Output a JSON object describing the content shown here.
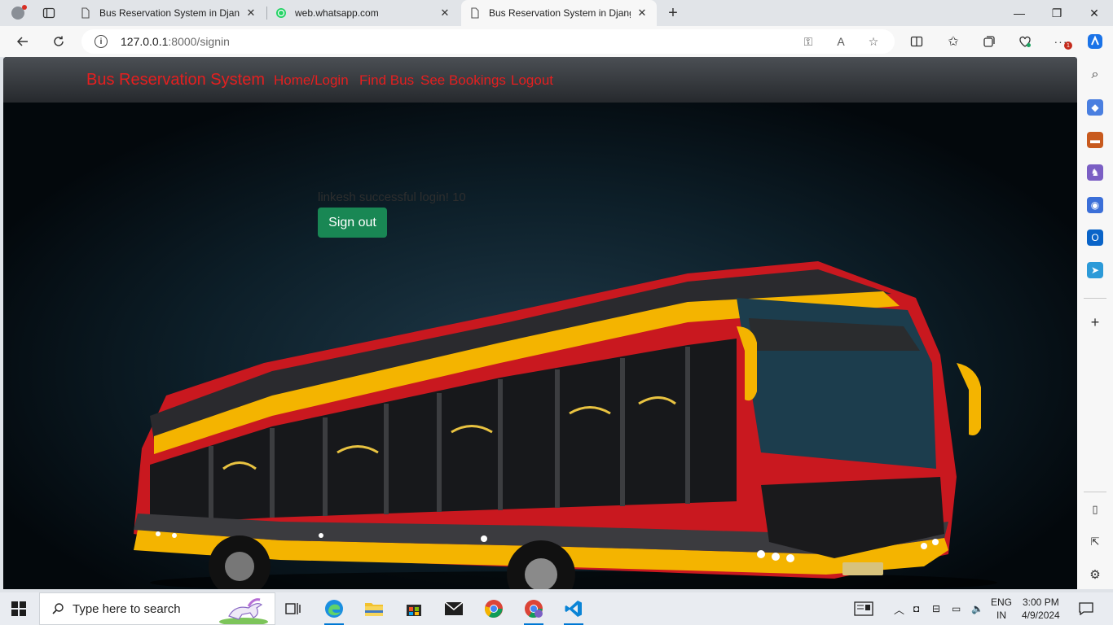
{
  "browser": {
    "tabs": [
      {
        "title": "Bus Reservation System in Djang",
        "active": false
      },
      {
        "title": "web.whatsapp.com",
        "active": false
      },
      {
        "title": "Bus Reservation System in Djang",
        "active": true
      }
    ],
    "url_host": "127.0.0.1",
    "url_rest": ":8000/signin"
  },
  "site": {
    "brand": "Bus Reservation System",
    "nav": {
      "home": "Home/Login",
      "find_bus": "Find Bus",
      "bookings": "See Bookings",
      "logout": "Logout"
    },
    "message": "linkesh successful login! 10",
    "signout_label": "Sign out",
    "accent_color": "#e41f1f",
    "button_color": "#198754"
  },
  "taskbar": {
    "search_placeholder": "Type here to search",
    "lang_line1": "ENG",
    "lang_line2": "IN",
    "time": "3:00 PM",
    "date": "4/9/2024"
  }
}
